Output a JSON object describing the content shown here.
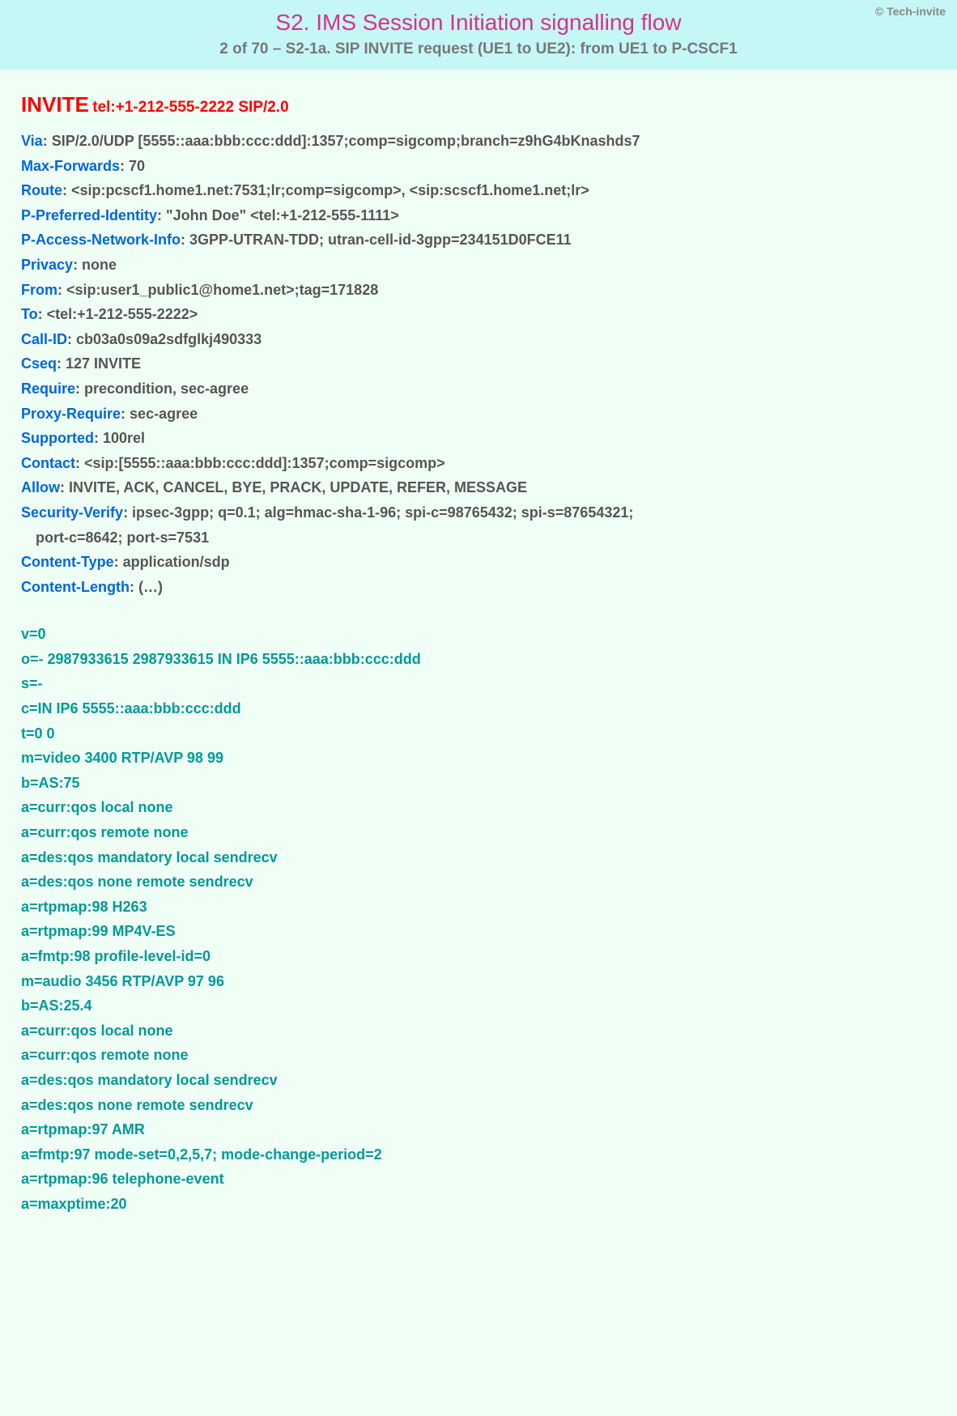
{
  "header": {
    "copyright": "© Tech-invite",
    "title": "S2. IMS Session Initiation signalling flow",
    "subtitle": "2 of 70 – S2-1a. SIP INVITE request (UE1 to UE2): from UE1 to P-CSCF1"
  },
  "request": {
    "method": "INVITE",
    "uri": "tel:+1-212-555-2222 SIP/2.0"
  },
  "sip_headers": [
    {
      "name": "Via",
      "value": ": SIP/2.0/UDP [5555::aaa:bbb:ccc:ddd]:1357;comp=sigcomp;branch=z9hG4bKnashds7"
    },
    {
      "name": "Max-Forwards",
      "value": ": 70"
    },
    {
      "name": "Route",
      "value": ": <sip:pcscf1.home1.net:7531;lr;comp=sigcomp>, <sip:scscf1.home1.net;lr>"
    },
    {
      "name": "P-Preferred-Identity",
      "value": ": \"John Doe\" <tel:+1-212-555-1111>"
    },
    {
      "name": "P-Access-Network-Info",
      "value": ": 3GPP-UTRAN-TDD; utran-cell-id-3gpp=234151D0FCE11"
    },
    {
      "name": "Privacy",
      "value": ": none"
    },
    {
      "name": "From",
      "value": ": <sip:user1_public1@home1.net>;tag=171828"
    },
    {
      "name": "To",
      "value": ": <tel:+1-212-555-2222>"
    },
    {
      "name": "Call-ID",
      "value": ": cb03a0s09a2sdfglkj490333"
    },
    {
      "name": "Cseq",
      "value": ": 127 INVITE"
    },
    {
      "name": "Require",
      "value": ": precondition, sec-agree"
    },
    {
      "name": "Proxy-Require",
      "value": ": sec-agree"
    },
    {
      "name": "Supported",
      "value": ": 100rel"
    },
    {
      "name": "Contact",
      "value": ": <sip:[5555::aaa:bbb:ccc:ddd]:1357;comp=sigcomp>"
    },
    {
      "name": "Allow",
      "value": ": INVITE, ACK, CANCEL, BYE, PRACK, UPDATE, REFER, MESSAGE"
    },
    {
      "name": "Security-Verify",
      "value": ": ipsec-3gpp; q=0.1; alg=hmac-sha-1-96; spi-c=98765432; spi-s=87654321;",
      "cont": "port-c=8642; port-s=7531"
    },
    {
      "name": "Content-Type",
      "value": ": application/sdp"
    },
    {
      "name": "Content-Length",
      "value": ": (…)"
    }
  ],
  "sdp": [
    "v=0",
    "o=- 2987933615 2987933615 IN IP6 5555::aaa:bbb:ccc:ddd",
    "s=-",
    "c=IN IP6 5555::aaa:bbb:ccc:ddd",
    "t=0 0",
    "m=video 3400 RTP/AVP 98 99",
    "b=AS:75",
    "a=curr:qos local none",
    "a=curr:qos remote none",
    "a=des:qos mandatory local sendrecv",
    "a=des:qos none remote sendrecv",
    "a=rtpmap:98 H263",
    "a=rtpmap:99 MP4V-ES",
    "a=fmtp:98 profile-level-id=0",
    "m=audio 3456 RTP/AVP 97 96",
    "b=AS:25.4",
    "a=curr:qos local none",
    "a=curr:qos remote none",
    "a=des:qos mandatory local sendrecv",
    "a=des:qos none remote sendrecv",
    "a=rtpmap:97 AMR",
    "a=fmtp:97 mode-set=0,2,5,7; mode-change-period=2",
    "a=rtpmap:96 telephone-event",
    "a=maxptime:20"
  ]
}
